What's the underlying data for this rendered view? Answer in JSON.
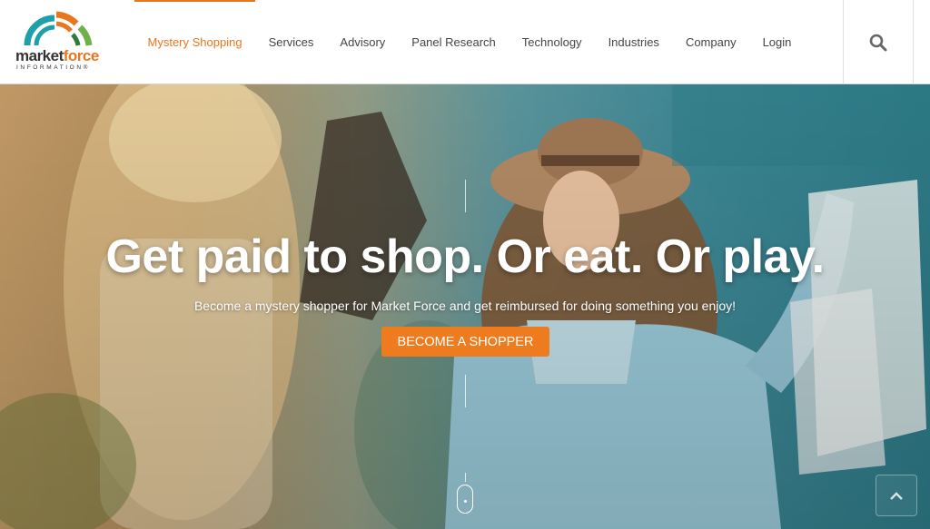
{
  "brand": {
    "name_part1": "market",
    "name_part2": "force",
    "tagline": "INFORMATION®",
    "colors": {
      "orange": "#e8761e",
      "teal": "#1f9fa8",
      "green": "#6fb04b",
      "dark": "#333333"
    }
  },
  "nav": {
    "items": [
      {
        "label": "Mystery Shopping",
        "active": true
      },
      {
        "label": "Services"
      },
      {
        "label": "Advisory"
      },
      {
        "label": "Panel Research"
      },
      {
        "label": "Technology"
      },
      {
        "label": "Industries"
      },
      {
        "label": "Company"
      },
      {
        "label": "Login"
      }
    ],
    "search_icon": "search-icon"
  },
  "hero": {
    "title": "Get paid to shop. Or eat. Or play.",
    "subtitle": "Become a mystery shopper for Market Force and get reimbursed for doing something you enjoy!",
    "cta_label": "BECOME A SHOPPER",
    "cta_color": "#ef7b1f",
    "scroll_icon": "mouse-scroll-icon",
    "back_to_top_icon": "chevron-up-icon"
  }
}
